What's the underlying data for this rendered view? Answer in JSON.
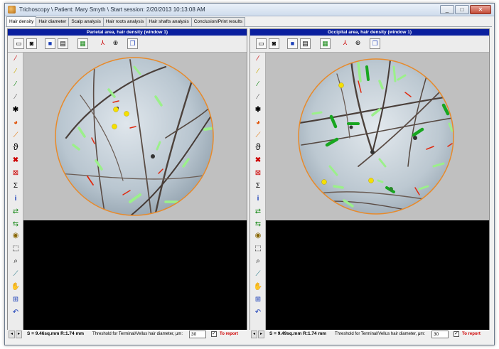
{
  "window": {
    "title": "Trichoscopy \\ Patient: Mary Smyth \\ Start session: 2/20/2013 10:13:08 AM",
    "controls": {
      "minimize": "_",
      "maximize": "□",
      "close": "✕"
    }
  },
  "tabs": [
    {
      "label": "Hair density",
      "active": true
    },
    {
      "label": "Hair diameter",
      "active": false
    },
    {
      "label": "Scalp analysis",
      "active": false
    },
    {
      "label": "Hair roots analysis",
      "active": false
    },
    {
      "label": "Hair shafts analysis",
      "active": false
    },
    {
      "label": "Conclusion/Print results",
      "active": false
    }
  ],
  "toolbar_icons": [
    "open-folder-icon",
    "camera-icon",
    "save-icon",
    "print-icon",
    "grid-icon",
    "measure-tool-icon",
    "target-icon",
    "copy-windows-icon"
  ],
  "side_tools": [
    "magic-wand-red-icon",
    "magic-wand-yellow-icon",
    "magic-wand-green-icon",
    "magic-wand-gray-icon",
    "star-icon",
    "color-wheel-icon",
    "ruler-icon",
    "calipers-icon",
    "delete-icon",
    "clear-selection-icon",
    "sigma-icon",
    "info-icon",
    "arrow-right-icon",
    "arrow-left-icon",
    "eye-icon",
    "select-rect-icon",
    "zoom-icon",
    "eyedropper-icon",
    "hand-icon",
    "fit-window-icon",
    "undo-icon"
  ],
  "panels": [
    {
      "header": "Parietal area, hair density (window 1)",
      "area_text": "S = 9.46sq.mm R:1.74 mm",
      "threshold_label": "Threshold for Terminal/Vellus hair diameter, μm:",
      "threshold_value": "30",
      "report_checked": true,
      "report_label": "To report"
    },
    {
      "header": "Occipital area, hair density (window 1)",
      "area_text": "S = 9.49sq.mm R:1.74 mm",
      "threshold_label": "Threshold for Terminal/Vellus hair diameter, μm:",
      "threshold_value": "30",
      "report_checked": true,
      "report_label": "To report"
    }
  ],
  "colors": {
    "panel_header": "#0a1f9e",
    "vellus_marker": "#9bf08a",
    "terminal_marker": "#18a620",
    "follicle_marker": "#ffff00",
    "red_marker": "#e02a10",
    "circle_border": "#e88a2a"
  }
}
